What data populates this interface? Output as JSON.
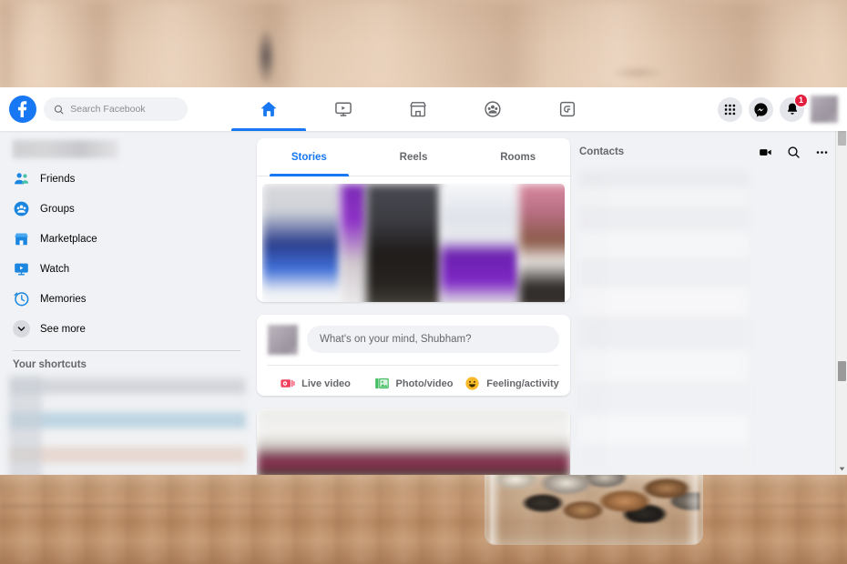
{
  "app": {
    "name": "Facebook",
    "accent_color": "#1877f2",
    "badge_color": "#e41e3f",
    "page_background": "#f0f2f5",
    "card_background": "#ffffff"
  },
  "topbar": {
    "logo_icon": "facebook-logo-icon",
    "search": {
      "placeholder": "Search Facebook",
      "value": "",
      "icon": "search-icon"
    },
    "nav_tabs": [
      {
        "id": "home",
        "icon": "home-icon",
        "active": true
      },
      {
        "id": "watch",
        "icon": "watch-icon",
        "active": false
      },
      {
        "id": "marketplace",
        "icon": "marketplace-icon",
        "active": false
      },
      {
        "id": "groups",
        "icon": "groups-icon",
        "active": false
      },
      {
        "id": "gaming",
        "icon": "gaming-icon",
        "active": false
      }
    ],
    "right_actions": [
      {
        "id": "menu",
        "icon": "grid-menu-icon",
        "badge": ""
      },
      {
        "id": "messenger",
        "icon": "messenger-icon",
        "badge": ""
      },
      {
        "id": "notifications",
        "icon": "bell-icon",
        "badge": "1"
      }
    ],
    "profile_avatar": "avatar"
  },
  "sidebar": {
    "profile_name": "",
    "items": [
      {
        "label": "Friends",
        "icon": "friends-icon"
      },
      {
        "label": "Groups",
        "icon": "groups-icon"
      },
      {
        "label": "Marketplace",
        "icon": "marketplace-icon"
      },
      {
        "label": "Watch",
        "icon": "watch-icon"
      },
      {
        "label": "Memories",
        "icon": "memories-clock-icon"
      }
    ],
    "see_more": {
      "label": "See more",
      "icon": "chevron-down-icon"
    },
    "shortcuts_title": "Your shortcuts"
  },
  "feed": {
    "story_tabs": [
      {
        "label": "Stories",
        "active": true
      },
      {
        "label": "Reels",
        "active": false
      },
      {
        "label": "Rooms",
        "active": false
      }
    ],
    "composer": {
      "placeholder": "What's on your mind, Shubham?",
      "value": "",
      "actions": [
        {
          "label": "Live video",
          "icon": "live-video-icon",
          "color": "#f3425f"
        },
        {
          "label": "Photo/video",
          "icon": "photo-video-icon",
          "color": "#45bd62"
        },
        {
          "label": "Feeling/activity",
          "icon": "feeling-activity-icon",
          "color": "#f7b928"
        }
      ]
    }
  },
  "contacts": {
    "title": "Contacts",
    "actions": [
      {
        "id": "video-room",
        "icon": "video-camera-icon"
      },
      {
        "id": "search",
        "icon": "search-icon"
      },
      {
        "id": "options",
        "icon": "more-horizontal-icon"
      }
    ]
  },
  "scrollbar": {
    "up_icon": "scroll-up-arrow-icon",
    "down_icon": "scroll-down-arrow-icon"
  }
}
